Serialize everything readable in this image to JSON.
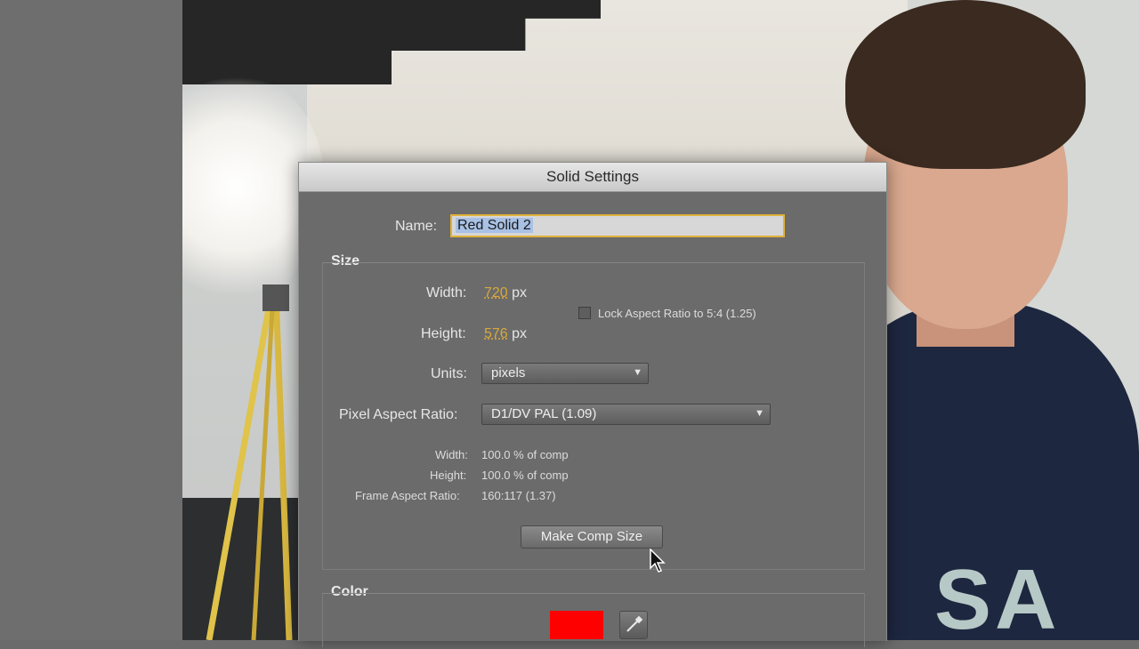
{
  "dialog": {
    "title": "Solid Settings",
    "name_label": "Name:",
    "name_value": "Red Solid 2",
    "size_section": "Size",
    "width_label": "Width:",
    "width_value": "720",
    "height_label": "Height:",
    "height_value": "576",
    "unit_px": "px",
    "lock_aspect_label": "Lock Aspect Ratio to 5:4 (1.25)",
    "lock_aspect_checked": false,
    "units_label": "Units:",
    "units_value": "pixels",
    "par_label": "Pixel Aspect Ratio:",
    "par_value": "D1/DV PAL (1.09)",
    "info_width_label": "Width:",
    "info_width_value": "100.0 % of comp",
    "info_height_label": "Height:",
    "info_height_value": "100.0 % of comp",
    "frame_aspect_label": "Frame Aspect Ratio:",
    "frame_aspect_value": "160:117 (1.37)",
    "make_comp_size_button": "Make Comp Size",
    "color_section": "Color",
    "color_value": "#ff0000"
  },
  "background": {
    "shirt_text": "SA"
  }
}
